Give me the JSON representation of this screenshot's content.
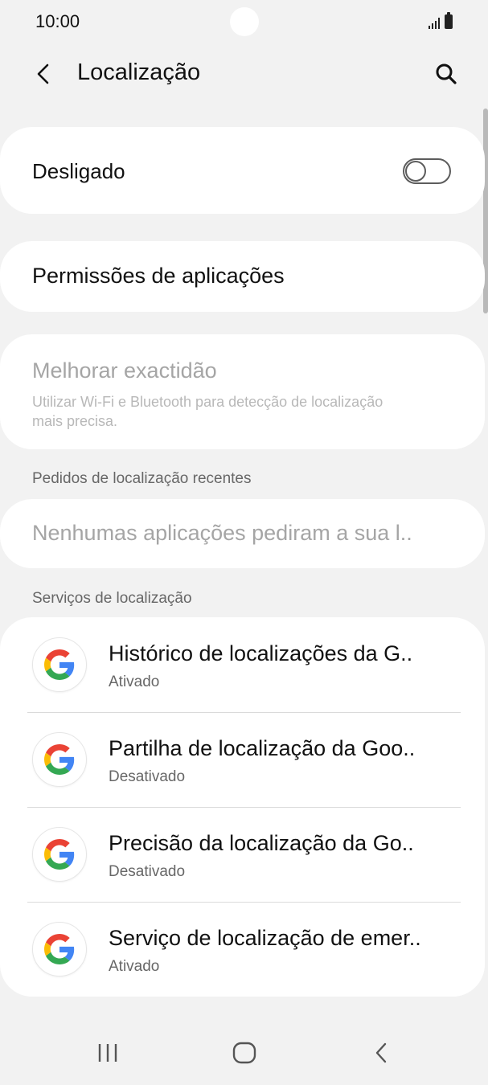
{
  "status_bar": {
    "time": "10:00"
  },
  "header": {
    "title": "Localização",
    "back_icon": "chevron-left-icon",
    "search_icon": "search-icon"
  },
  "location_toggle": {
    "label": "Desligado",
    "enabled": false
  },
  "permissions": {
    "label": "Permissões de aplicações"
  },
  "accuracy": {
    "title": "Melhorar exactidão",
    "description": "Utilizar Wi-Fi e Bluetooth para detecção de localização mais precisa."
  },
  "recent_requests": {
    "header": "Pedidos de localização recentes",
    "empty_text": "Nenhumas aplicações pediram a sua l.."
  },
  "services": {
    "header": "Serviços de localização",
    "items": [
      {
        "title": "Histórico de localizações da G..",
        "status": "Ativado",
        "icon": "google-icon"
      },
      {
        "title": "Partilha de localização da Goo..",
        "status": "Desativado",
        "icon": "google-icon"
      },
      {
        "title": "Precisão da localização da Go..",
        "status": "Desativado",
        "icon": "google-icon"
      },
      {
        "title": "Serviço de localização de emer..",
        "status": "Ativado",
        "icon": "google-icon"
      }
    ]
  },
  "nav_bar": {
    "recents_icon": "recent-apps-icon",
    "home_icon": "home-icon",
    "back_icon": "nav-back-icon"
  },
  "colors": {
    "background": "#f2f2f2",
    "card": "#ffffff",
    "disabled_text": "#a5a5a5",
    "secondary_text": "#676767",
    "google_blue": "#4285F4",
    "google_red": "#EA4335",
    "google_yellow": "#FBBC05",
    "google_green": "#34A853"
  }
}
